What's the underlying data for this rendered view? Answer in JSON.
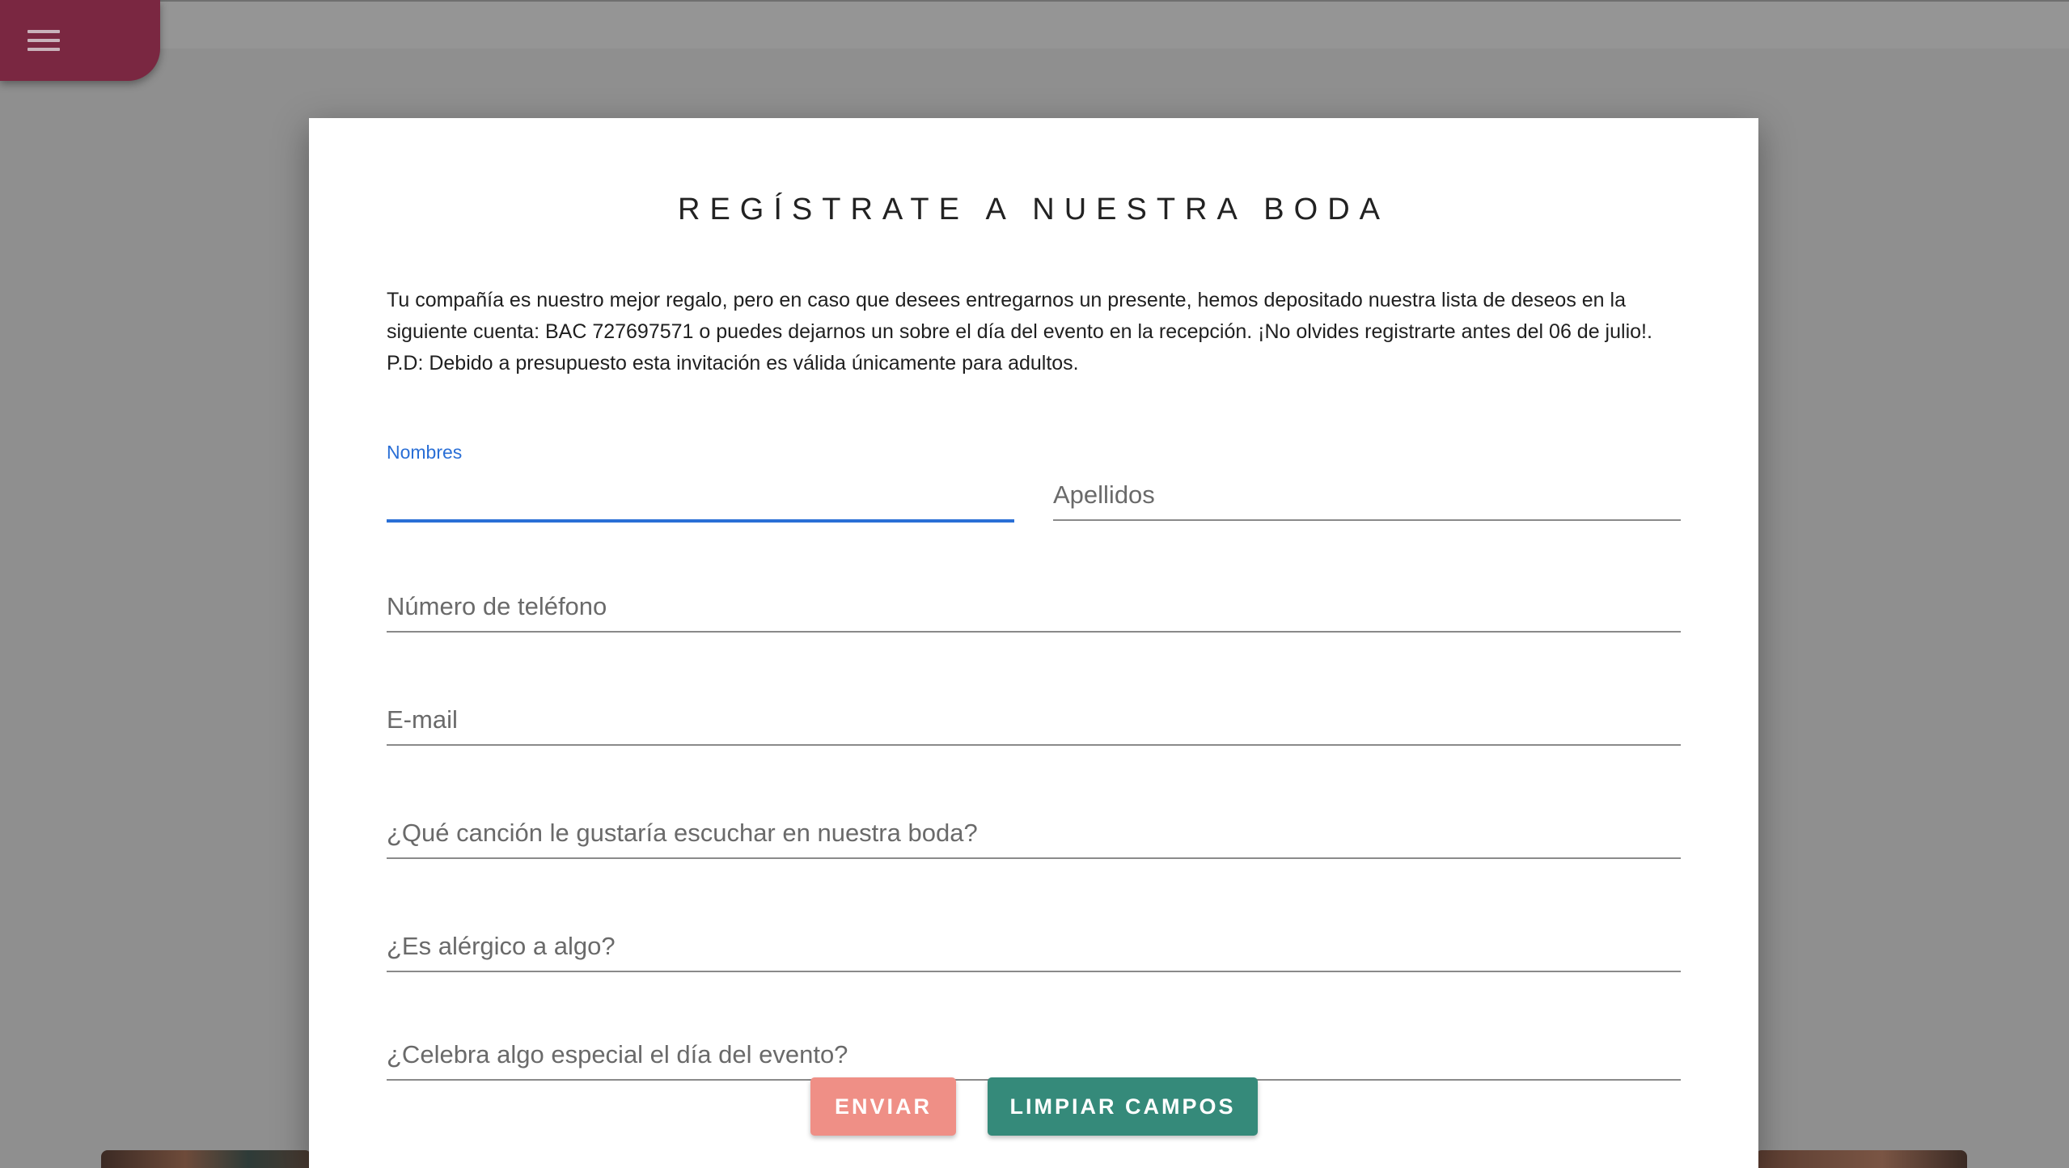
{
  "menu": {
    "icon": "hamburger-menu-icon"
  },
  "dialog": {
    "title": "REGÍSTRATE A NUESTRA BODA",
    "intro_lines": [
      "Tu compañía es nuestro mejor regalo, pero en caso que desees entregarnos un presente, hemos depositado nuestra lista de deseos en la",
      "siguiente cuenta: BAC 727697571 o puedes dejarnos un sobre el día del evento en la recepción. ¡No olvides registrarte antes del 06 de julio!.",
      "P.D: Debido a presupuesto esta invitación es válida únicamente para adultos."
    ]
  },
  "form": {
    "nombres_label": "Nombres",
    "nombres_value": "",
    "apellidos_label": "Apellidos",
    "telefono_label": "Número de teléfono",
    "email_label": "E-mail",
    "cancion_label": "¿Qué canción le gustaría escuchar en nuestra boda?",
    "alergico_label": "¿Es alérgico a algo?",
    "celebra_label": "¿Celebra algo especial el día del evento?"
  },
  "buttons": {
    "send_label": "ENVIAR",
    "clear_label": "LIMPIAR CAMPOS"
  },
  "colors": {
    "menu_tab": "#7a2741",
    "focus_blue": "#2a6fd6",
    "send_button": "#ef8f86",
    "clear_button": "#358a7a"
  }
}
